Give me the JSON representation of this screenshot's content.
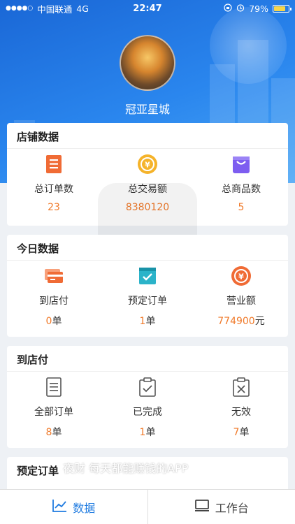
{
  "status": {
    "signal": "●●●●○",
    "carrier": "中国联通",
    "network": "4G",
    "time": "22:47",
    "battery": "79%"
  },
  "shop": {
    "name": "冠亚星城"
  },
  "store_data": {
    "title": "店铺数据",
    "items": [
      {
        "label": "总订单数",
        "value": "23",
        "icon": "order-list-icon"
      },
      {
        "label": "总交易额",
        "value": "8380120",
        "icon": "yen-coin-icon"
      },
      {
        "label": "总商品数",
        "value": "5",
        "icon": "shopping-bag-icon"
      }
    ]
  },
  "today_data": {
    "title": "今日数据",
    "items": [
      {
        "label": "到店付",
        "value": "0",
        "unit": "单",
        "icon": "card-icon"
      },
      {
        "label": "预定订单",
        "value": "1",
        "unit": "单",
        "icon": "calendar-check-icon"
      },
      {
        "label": "营业额",
        "value": "774900",
        "unit": "元",
        "icon": "yen-coin-icon"
      }
    ]
  },
  "pay_in_store": {
    "title": "到店付",
    "items": [
      {
        "label": "全部订单",
        "value": "8",
        "unit": "单",
        "icon": "document-icon"
      },
      {
        "label": "已完成",
        "value": "1",
        "unit": "单",
        "icon": "clipboard-check-icon"
      },
      {
        "label": "无效",
        "value": "7",
        "unit": "单",
        "icon": "clipboard-x-icon"
      }
    ]
  },
  "reservations": {
    "title": "预定订单"
  },
  "banner": {
    "text": "夜财 每天都能赚钱的APP"
  },
  "tabs": [
    {
      "label": "数据",
      "icon": "chart-line-icon",
      "active": true
    },
    {
      "label": "工作台",
      "icon": "monitor-icon",
      "active": false
    }
  ],
  "colors": {
    "accent": "#1f7be0",
    "value": "#f07a2a",
    "hero": "#2a86ee"
  }
}
